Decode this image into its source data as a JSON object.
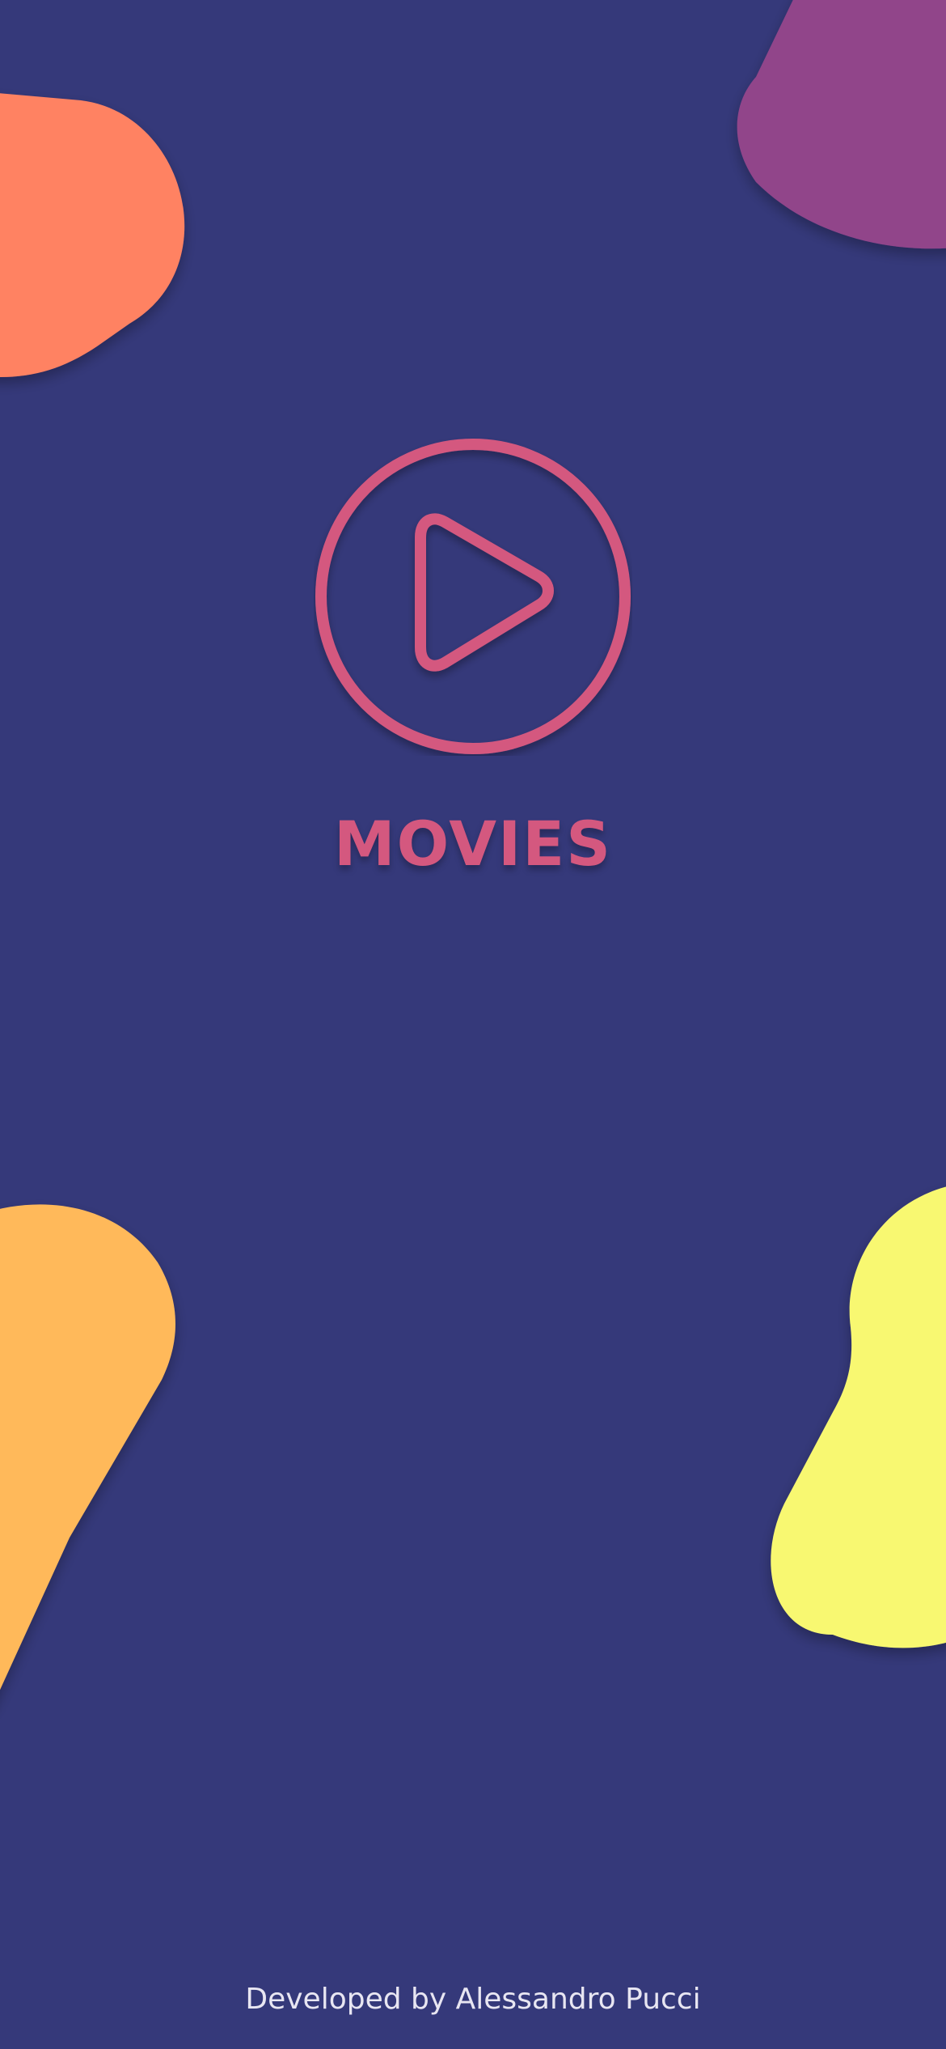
{
  "app": {
    "title": "MOVIES",
    "credit": "Developed by Alessandro Pucci"
  },
  "logo": {
    "icon": "play-circle-icon"
  },
  "colors": {
    "background": "#35397a",
    "accent": "#d4587f",
    "credit_text": "#e8e6f2",
    "blob_orange": "#ff8262",
    "blob_purple": "#91458a",
    "blob_amber": "#ffb95a",
    "blob_yellow": "#f8f871"
  }
}
